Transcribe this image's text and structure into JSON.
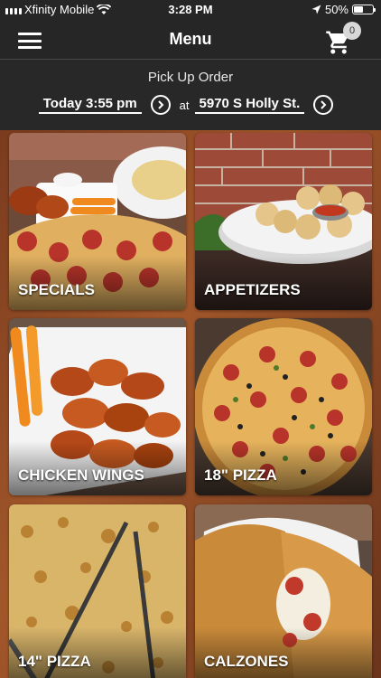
{
  "status_bar": {
    "carrier": "Xfinity Mobile",
    "time": "3:28 PM",
    "battery_percent": "50%",
    "battery_level": 0.5
  },
  "nav": {
    "title": "Menu",
    "cart_count": "0"
  },
  "order": {
    "title": "Pick Up Order",
    "time_label": "Today 3:55 pm",
    "at_label": "at",
    "location_label": "5970 S Holly St."
  },
  "categories": [
    {
      "label": "SPECIALS"
    },
    {
      "label": "APPETIZERS"
    },
    {
      "label": "CHICKEN WINGS"
    },
    {
      "label": "18\" PIZZA"
    },
    {
      "label": "14\" PIZZA"
    },
    {
      "label": "CALZONES"
    }
  ],
  "colors": {
    "bar_background": "#262626",
    "order_background": "#282828",
    "badge_background": "#d8d8d8"
  }
}
